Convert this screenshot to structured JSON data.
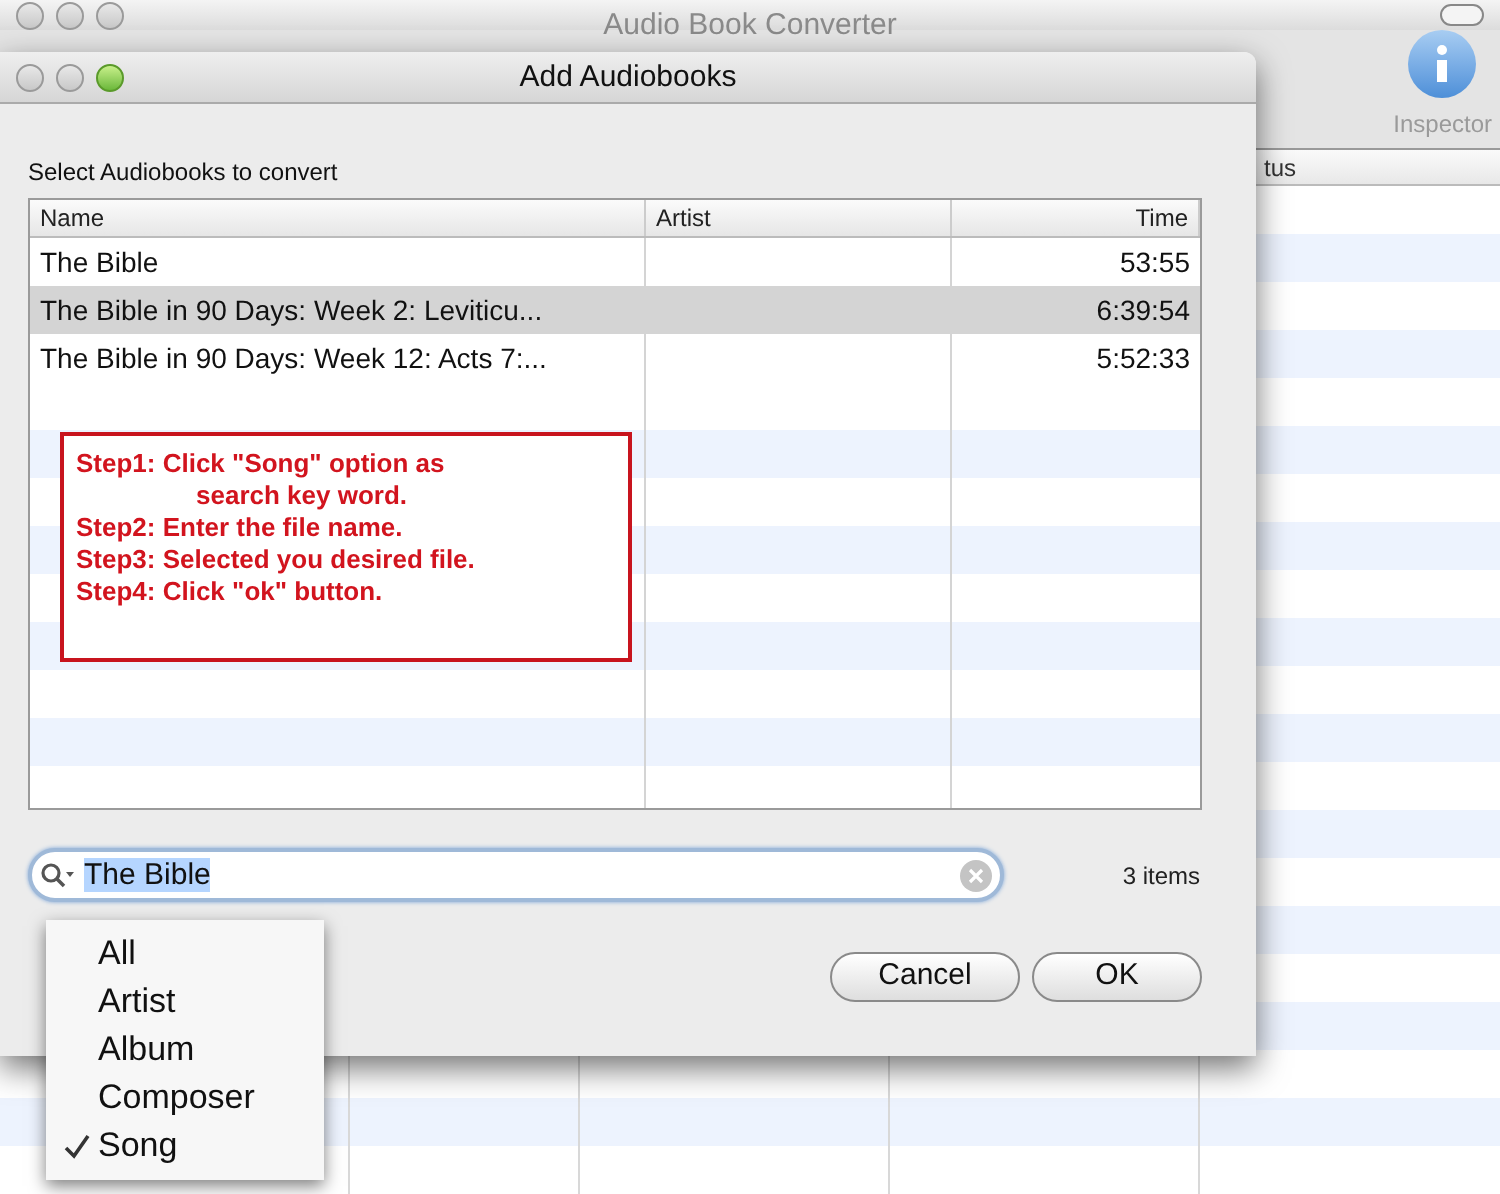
{
  "main_window": {
    "title": "Audio Book Converter",
    "toolbar": [
      {
        "label": "Inspector"
      }
    ],
    "table": {
      "visible_header": "tus"
    }
  },
  "dialog": {
    "title": "Add Audiobooks",
    "prompt": "Select Audiobooks to convert",
    "table": {
      "columns": [
        {
          "label": "Name"
        },
        {
          "label": "Artist"
        },
        {
          "label": "Time"
        }
      ],
      "rows": [
        {
          "name": "The Bible",
          "time": "53:55",
          "selected": false
        },
        {
          "name": "The Bible in 90 Days: Week 2: Leviticu...",
          "time": "6:39:54",
          "selected": true
        },
        {
          "name": "The Bible in 90 Days: Week 12: Acts 7:...",
          "time": "5:52:33",
          "selected": false
        }
      ]
    },
    "annotation": [
      {
        "text": "Step1: Click \"Song\" option as",
        "kind": "step"
      },
      {
        "text": "search key word.",
        "kind": "continuation"
      },
      {
        "text": "Step2: Enter the file name.",
        "kind": "step"
      },
      {
        "text": "Step3: Selected you desired file.",
        "kind": "step"
      },
      {
        "text": "Step4: Click \"ok\" button.",
        "kind": "step"
      }
    ],
    "search": {
      "value": "The Bible",
      "highlighted": true
    },
    "item_count": "3 items",
    "buttons": [
      {
        "label": "Cancel"
      },
      {
        "label": "OK"
      }
    ]
  },
  "search_menu": [
    {
      "label": "All",
      "checked": false
    },
    {
      "label": "Artist",
      "checked": false
    },
    {
      "label": "Album",
      "checked": false
    },
    {
      "label": "Composer",
      "checked": false
    },
    {
      "label": "Song",
      "checked": true
    }
  ]
}
